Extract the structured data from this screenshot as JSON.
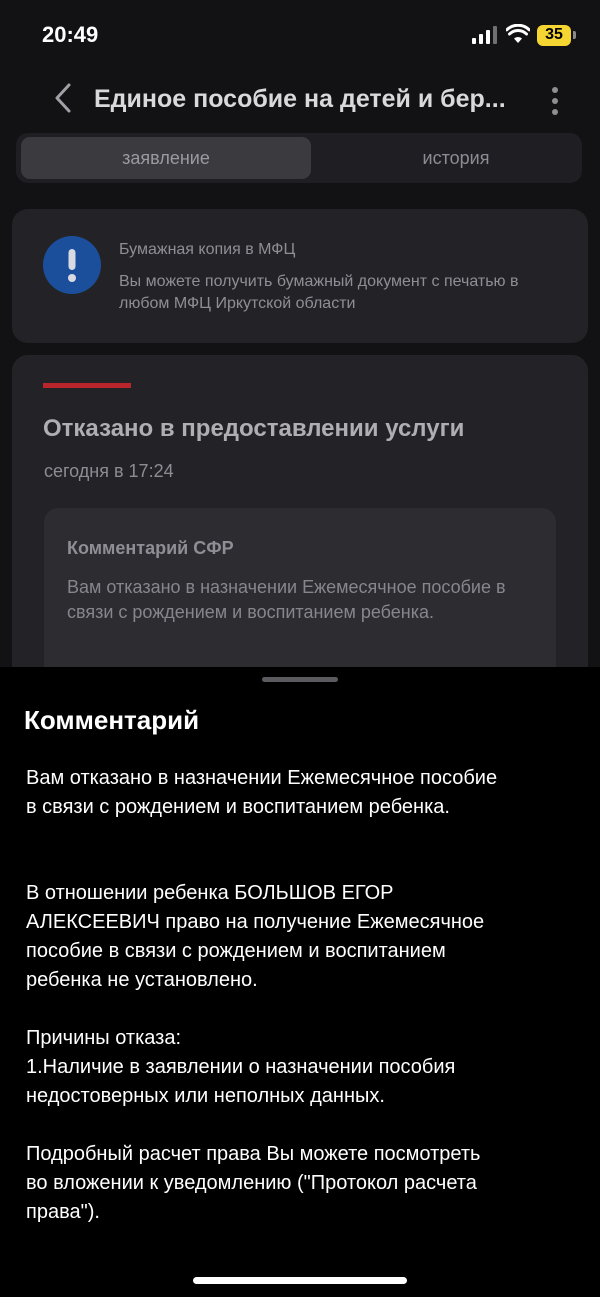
{
  "status_bar": {
    "time": "20:49",
    "battery": "35"
  },
  "header": {
    "title": "Единое пособие на детей и бер..."
  },
  "tabs": [
    {
      "label": "заявление",
      "active": true
    },
    {
      "label": "история",
      "active": false
    }
  ],
  "info_card": {
    "title": "Бумажная копия в МФЦ",
    "text": "Вы можете получить бумажный документ с печатью в любом МФЦ Иркутской области"
  },
  "status_card": {
    "title": "Отказано в предоставлении услуги",
    "time": "сегодня в 17:24",
    "comment_title": "Комментарий СФР",
    "comment_text": "Вам отказано в назначении Ежемесячное пособие в связи с рождением и воспитанием ребенка."
  },
  "sheet": {
    "title": "Комментарий",
    "paragraphs": [
      "Вам отказано в назначении Ежемесячное пособие\nв связи с рождением и воспитанием ребенка.",
      "В отношении ребенка БОЛЬШОВ ЕГОР\nАЛЕКСЕЕВИЧ право на получение Ежемесячное\nпособие в связи с рождением и воспитанием\nребенка не установлено.",
      "Причины отказа:\n1.Наличие в заявлении о назначении пособия\nнедостоверных или неполных данных.",
      "Подробный расчет права Вы можете посмотреть\nво вложении к уведомлению (\"Протокол расчета\nправа\")."
    ]
  },
  "colors": {
    "accent_red": "#b8262b",
    "alert_blue": "#1b4f9c",
    "battery_yellow": "#f5d531"
  },
  "icons": [
    "signal-icon",
    "wifi-icon",
    "back-icon",
    "more-icon",
    "alert-icon"
  ]
}
